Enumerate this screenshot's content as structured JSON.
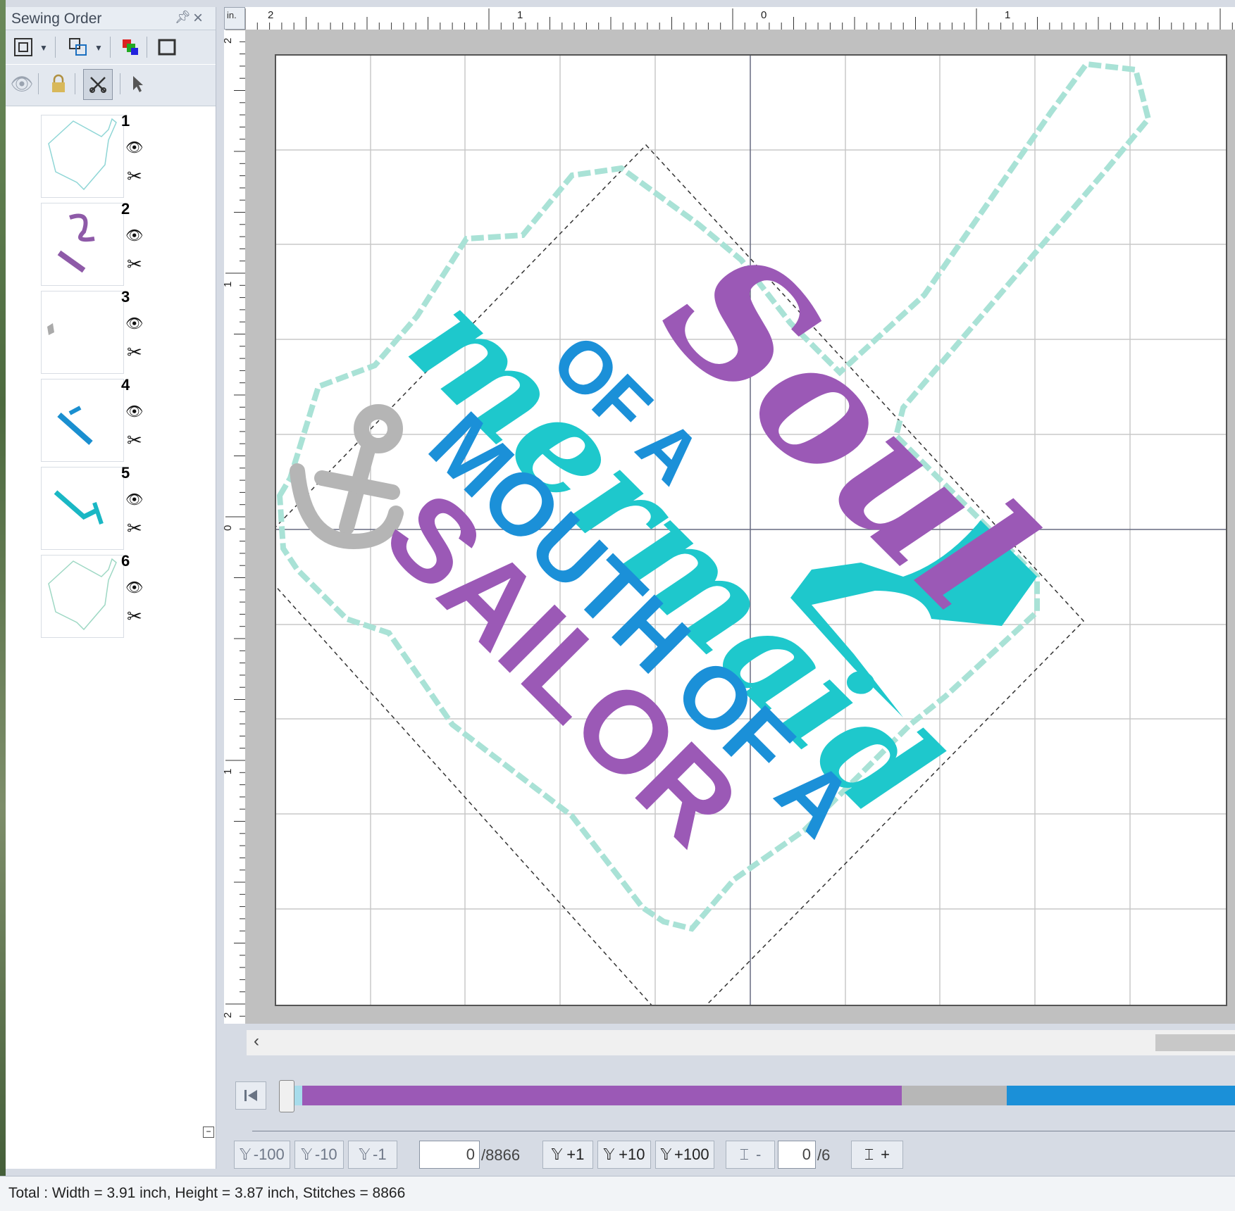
{
  "panel": {
    "title": "Sewing Order",
    "items": [
      {
        "num": "1",
        "thumb_color": "#9ed8d8"
      },
      {
        "num": "2",
        "thumb_color": "#8e5aa8"
      },
      {
        "num": "3",
        "thumb_color": "#b0b0b0"
      },
      {
        "num": "4",
        "thumb_color": "#1a8fd0"
      },
      {
        "num": "5",
        "thumb_color": "#1ab7c4"
      },
      {
        "num": "6",
        "thumb_color": "#9ed8c4"
      }
    ]
  },
  "ruler": {
    "unit": "in.",
    "top_labels": [
      "2",
      "1",
      "0",
      "1"
    ],
    "left_labels": [
      "2",
      "1",
      "0",
      "1",
      "2"
    ]
  },
  "design": {
    "line1": "Soul",
    "line2": "mermaid",
    "line3": "OF A",
    "line4": "MOUTH OF A",
    "line5": "SAILOR",
    "colors": {
      "purple": "#9b59b6",
      "teal": "#1ec8cc",
      "blue": "#1b90d8",
      "gray": "#b5b5b5",
      "outline": "#a9e2d6"
    }
  },
  "simulator": {
    "buttons": [
      "-100",
      "-10",
      "-1",
      "+1",
      "+10",
      "+100"
    ],
    "stitch_current": "0",
    "stitch_total": "/8866",
    "color_current": "0",
    "color_total": "/6",
    "color_minus": "-",
    "color_plus": "+",
    "progress_segments": [
      {
        "color": "#a7dceb",
        "fraction": 0.02
      },
      {
        "color": "#9b59b6",
        "fraction": 0.63
      },
      {
        "color": "#b7b7b7",
        "fraction": 0.11
      },
      {
        "color": "#1b90d8",
        "fraction": 0.24
      }
    ]
  },
  "status": {
    "text": "Total : Width = 3.91 inch, Height = 3.87 inch, Stitches = 8866"
  }
}
